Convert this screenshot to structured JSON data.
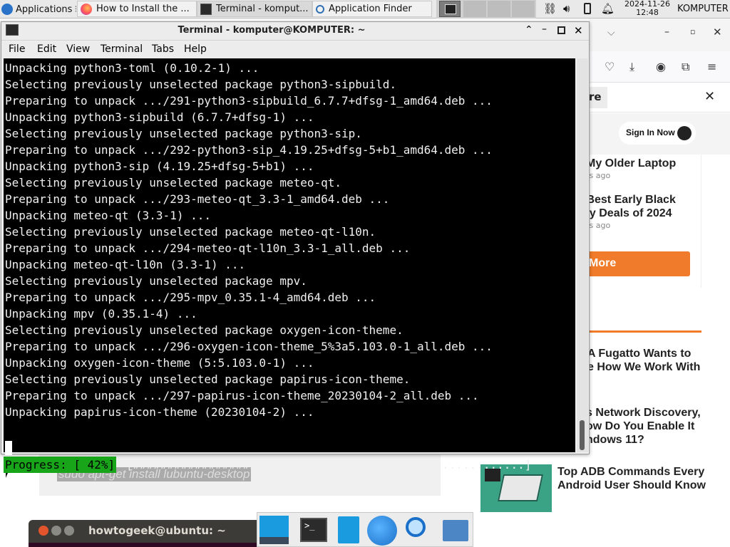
{
  "panel": {
    "applications_label": "Applications",
    "tasks": [
      {
        "label": "How to Install the ...",
        "icon": "firefox-icon"
      },
      {
        "label": "Terminal - komput...",
        "icon": "terminal-icon"
      },
      {
        "label": "Application Finder",
        "icon": "search-icon"
      }
    ],
    "date": "2024-11-26",
    "time": "12:48",
    "user": "KOMPUTER"
  },
  "terminal": {
    "title": "Terminal - komputer@KOMPUTER: ~",
    "menu": [
      "File",
      "Edit",
      "View",
      "Terminal",
      "Tabs",
      "Help"
    ],
    "lines": [
      "Unpacking python3-toml (0.10.2-1) ...",
      "Selecting previously unselected package python3-sipbuild.",
      "Preparing to unpack .../291-python3-sipbuild_6.7.7+dfsg-1_amd64.deb ...",
      "Unpacking python3-sipbuild (6.7.7+dfsg-1) ...",
      "Selecting previously unselected package python3-sip.",
      "Preparing to unpack .../292-python3-sip_4.19.25+dfsg-5+b1_amd64.deb ...",
      "Unpacking python3-sip (4.19.25+dfsg-5+b1) ...",
      "Selecting previously unselected package meteo-qt.",
      "Preparing to unpack .../293-meteo-qt_3.3-1_amd64.deb ...",
      "Unpacking meteo-qt (3.3-1) ...",
      "Selecting previously unselected package meteo-qt-l10n.",
      "Preparing to unpack .../294-meteo-qt-l10n_3.3-1_all.deb ...",
      "Unpacking meteo-qt-l10n (3.3-1) ...",
      "Selecting previously unselected package mpv.",
      "Preparing to unpack .../295-mpv_0.35.1-4_amd64.deb ...",
      "Unpacking mpv (0.35.1-4) ...",
      "Selecting previously unselected package oxygen-icon-theme.",
      "Preparing to unpack .../296-oxygen-icon-theme_5%3a5.103.0-1_all.deb ...",
      "Unpacking oxygen-icon-theme (5:5.103.0-1) ...",
      "Selecting previously unselected package papirus-icon-theme.",
      "Preparing to unpack .../297-papirus-icon-theme_20230104-2_all.deb ...",
      "Unpacking papirus-icon-theme (20230104-2) ..."
    ],
    "progress_label": "Progress: [ 42%]",
    "progress_bar": "[########################.................................]",
    "progress_value": 0.42
  },
  "browser": {
    "search_partial": "re",
    "sign_in": "Sign In Now",
    "articles": [
      {
        "title": "My Older Laptop",
        "meta": "rs ago"
      },
      {
        "title": " Best Early Black\nay Deals of 2024",
        "meta": "rs ago"
      }
    ],
    "more_button": "More",
    "list": [
      "A Fugatto Wants to\ne How We Work With",
      "s Network Discovery,\now Do You Enable It\nndows 11?",
      "Top ADB Commands Every\nAndroid User Should Know"
    ],
    "code_snippet": "sudo apt-get install lubuntu-desktop"
  },
  "bg_terminal": {
    "title": "howtogeek@ubuntu: ~"
  },
  "colors": {
    "accent_orange": "#f07b2a",
    "progress_green": "#19a51a"
  }
}
